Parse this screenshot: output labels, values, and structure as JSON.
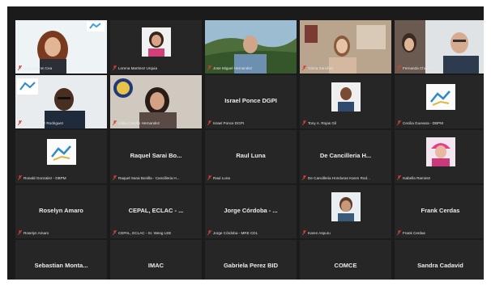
{
  "participants": [
    {
      "display": "Lidia Fromm Cea",
      "center": "",
      "kind": "video"
    },
    {
      "display": "Lorena Martinez Urquia",
      "center": "",
      "kind": "avatar"
    },
    {
      "display": "Jose Miguel Hernandez",
      "center": "",
      "kind": "video"
    },
    {
      "display": "Gloria Sanchez",
      "center": "",
      "kind": "video"
    },
    {
      "display": "Fernanda Chavez",
      "center": "",
      "kind": "video"
    },
    {
      "display": "Efren Gomez Rodriguez",
      "center": "",
      "kind": "video"
    },
    {
      "display": "Idalia Castillo Hernandez",
      "center": "",
      "kind": "video"
    },
    {
      "display": "Israel Ponce DGPI",
      "center": "Israel Ponce DGPI",
      "kind": "name"
    },
    {
      "display": "Tony A. Rojas Gil",
      "center": "",
      "kind": "avatar"
    },
    {
      "display": "Cecilia Guevara - DBPM",
      "center": "",
      "kind": "logo"
    },
    {
      "display": "Ronald Gonzalez - DBPM",
      "center": "",
      "kind": "logo"
    },
    {
      "display": "Raquel Sarai Bonilla - Cancilleria H...",
      "center": "Raquel Sarai Bo...",
      "kind": "name"
    },
    {
      "display": "Raul Luna",
      "center": "Raul Luna",
      "kind": "name"
    },
    {
      "display": "De Cancilleria Honduras Karen Rod...",
      "center": "De Cancilleria H...",
      "kind": "name"
    },
    {
      "display": "Isabella Ramirez",
      "center": "",
      "kind": "avatar"
    },
    {
      "display": "Roselyn Amaro",
      "center": "Roselyn Amaro",
      "kind": "name"
    },
    {
      "display": "CEPAL, ECLAC - Sr. Weng LEE",
      "center": "CEPAL, ECLAC - ...",
      "kind": "name"
    },
    {
      "display": "Jorge Córdoba - MRE CDL",
      "center": "Jorge Córdoba - ...",
      "kind": "name"
    },
    {
      "display": "Karen Aspuru",
      "center": "",
      "kind": "avatar"
    },
    {
      "display": "Frank Cerdas",
      "center": "Frank Cerdas",
      "kind": "name"
    },
    {
      "display": "",
      "center": "Sebastian Monta...",
      "kind": "name"
    },
    {
      "display": "",
      "center": "IMAC",
      "kind": "name"
    },
    {
      "display": "",
      "center": "Gabriela Perez BID",
      "kind": "name"
    },
    {
      "display": "",
      "center": "COMCE",
      "kind": "name"
    },
    {
      "display": "",
      "center": "Sandra Cadavid",
      "kind": "name"
    }
  ],
  "colors": {
    "muted_mic": "#d93a3a",
    "active_speaker": "#c9d96b",
    "tile_bg": "#262626",
    "window_bg": "#1b1b1b"
  },
  "icons": {
    "mic": "muted-mic-icon"
  }
}
